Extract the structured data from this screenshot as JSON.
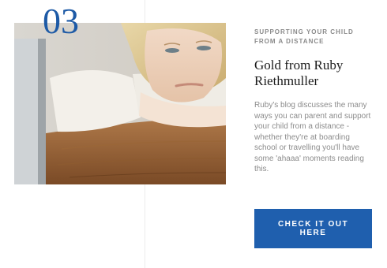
{
  "card": {
    "number": "03",
    "eyebrow": "SUPPORTING YOUR CHILD FROM A DISTANCE",
    "title": "Gold from Ruby Riethmuller",
    "description": "Ruby's blog discusses the many ways you can parent and support your child from a distance - whether they're at boarding school or travelling you'll have some 'ahaaa' moments reading this.",
    "cta_label": "CHECK IT OUT HERE"
  },
  "colors": {
    "accent": "#1f5fae",
    "number": "#1d5aa6"
  }
}
